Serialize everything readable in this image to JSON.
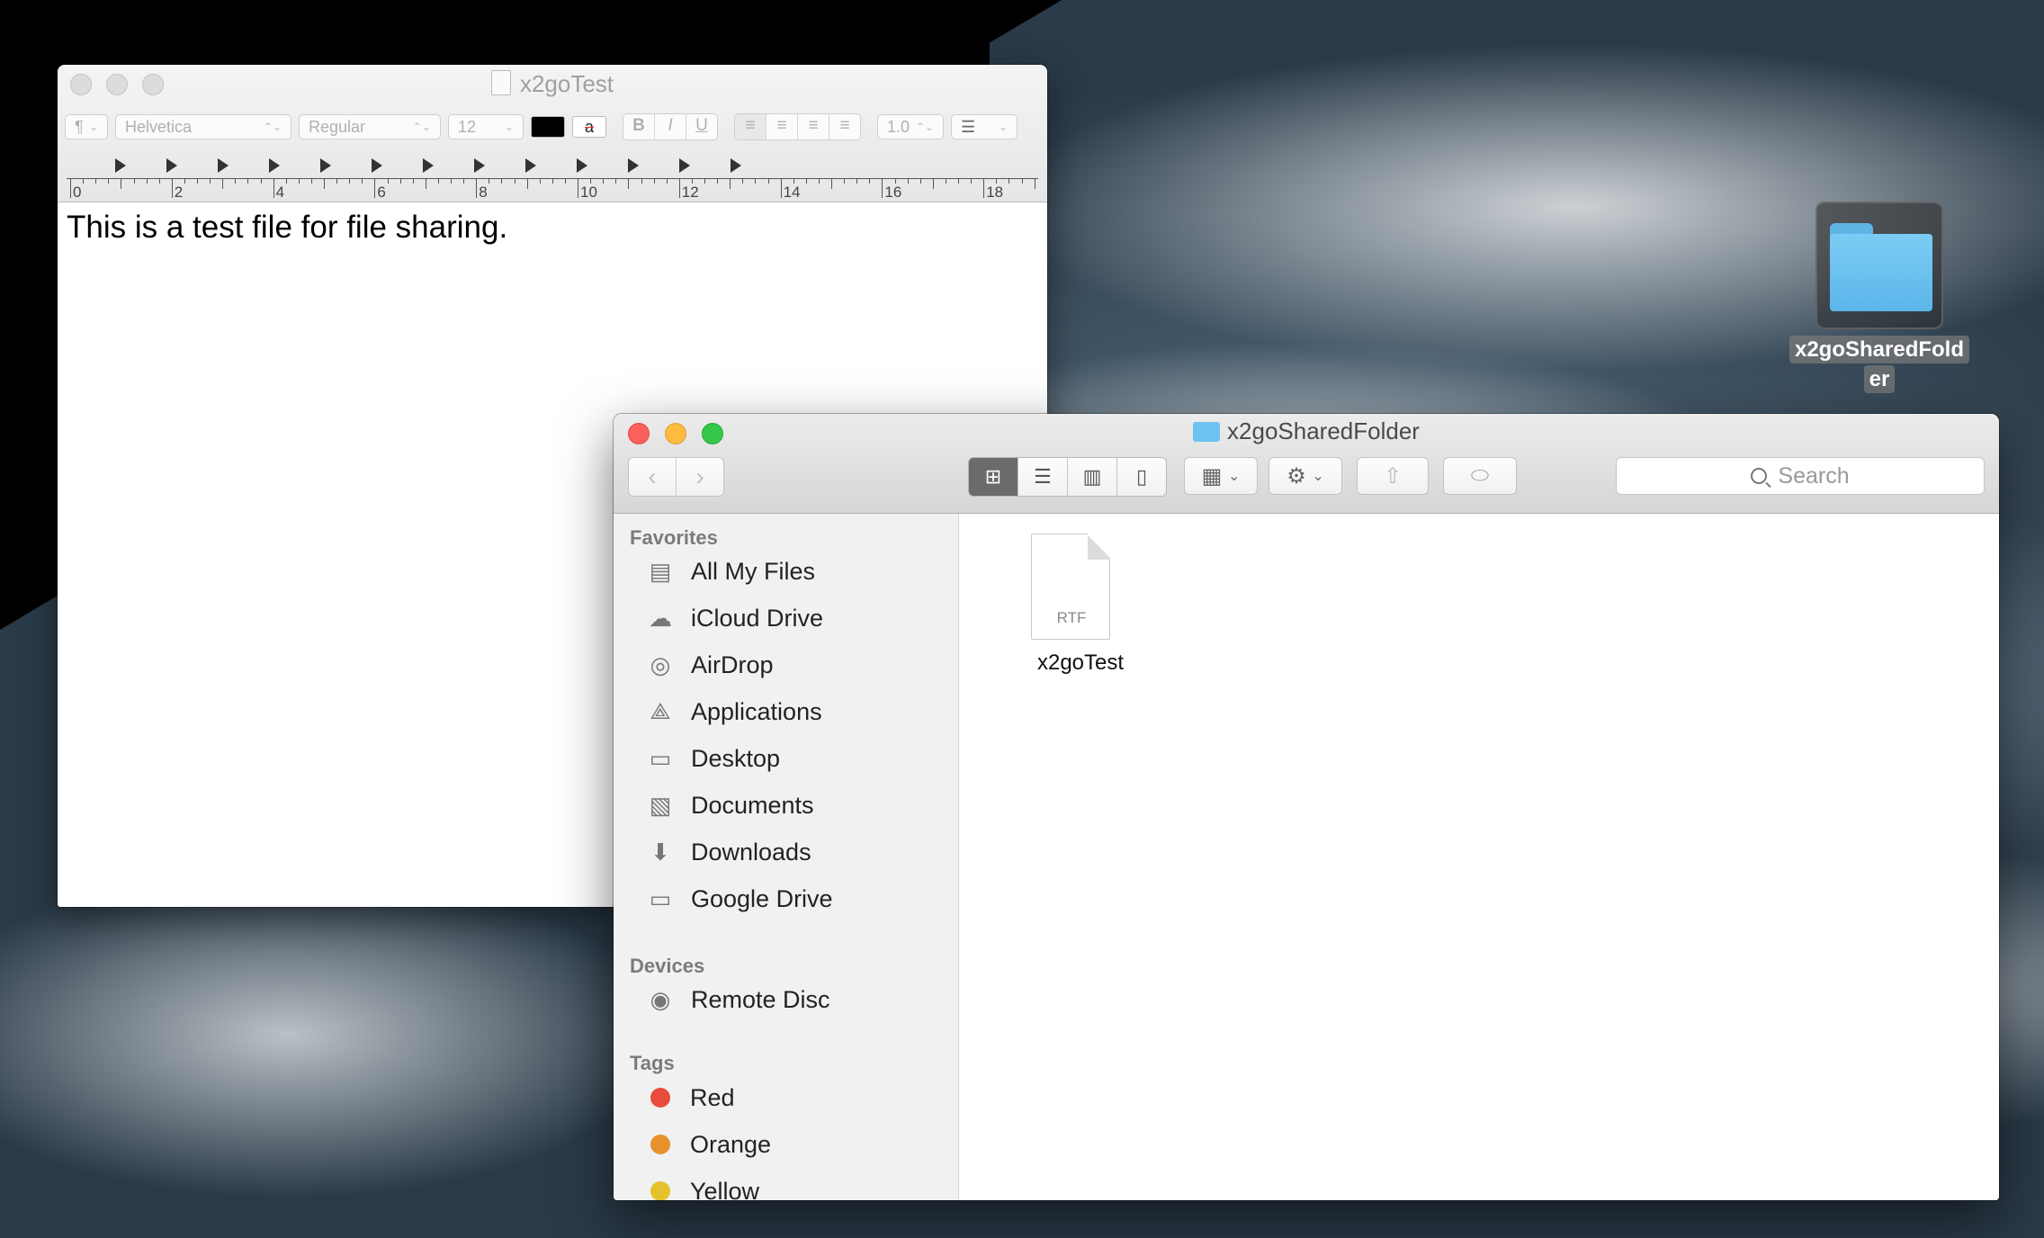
{
  "textedit": {
    "title": "x2goTest",
    "paragraph_style": "¶",
    "font_family": "Helvetica",
    "typeface": "Regular",
    "font_size": "12",
    "bold": "B",
    "italic": "I",
    "underline": "U",
    "line_spacing": "1.0",
    "bg_color_label": "a",
    "ruler_numbers": [
      "0",
      "2",
      "4",
      "6",
      "8",
      "10",
      "12",
      "14",
      "16",
      "18"
    ],
    "body_text": "This is a test file for file sharing."
  },
  "desktop": {
    "folder_label_line1": "x2goSharedFold",
    "folder_label_line2": "er"
  },
  "finder": {
    "title": "x2goSharedFolder",
    "search_placeholder": "Search",
    "sidebar": {
      "favorites_header": "Favorites",
      "favorites": [
        {
          "label": "All My Files",
          "icon": "all-files-icon"
        },
        {
          "label": "iCloud Drive",
          "icon": "cloud-icon"
        },
        {
          "label": "AirDrop",
          "icon": "airdrop-icon"
        },
        {
          "label": "Applications",
          "icon": "applications-icon"
        },
        {
          "label": "Desktop",
          "icon": "desktop-icon"
        },
        {
          "label": "Documents",
          "icon": "documents-icon"
        },
        {
          "label": "Downloads",
          "icon": "downloads-icon"
        },
        {
          "label": "Google Drive",
          "icon": "folder-icon"
        }
      ],
      "devices_header": "Devices",
      "devices": [
        {
          "label": "Remote Disc",
          "icon": "disc-icon"
        }
      ],
      "tags_header": "Tags",
      "tags": [
        {
          "label": "Red",
          "color": "#e74c3c"
        },
        {
          "label": "Orange",
          "color": "#e8912b"
        },
        {
          "label": "Yellow",
          "color": "#e5c22b"
        }
      ]
    },
    "files": [
      {
        "name": "x2goTest",
        "type_badge": "RTF"
      }
    ]
  }
}
